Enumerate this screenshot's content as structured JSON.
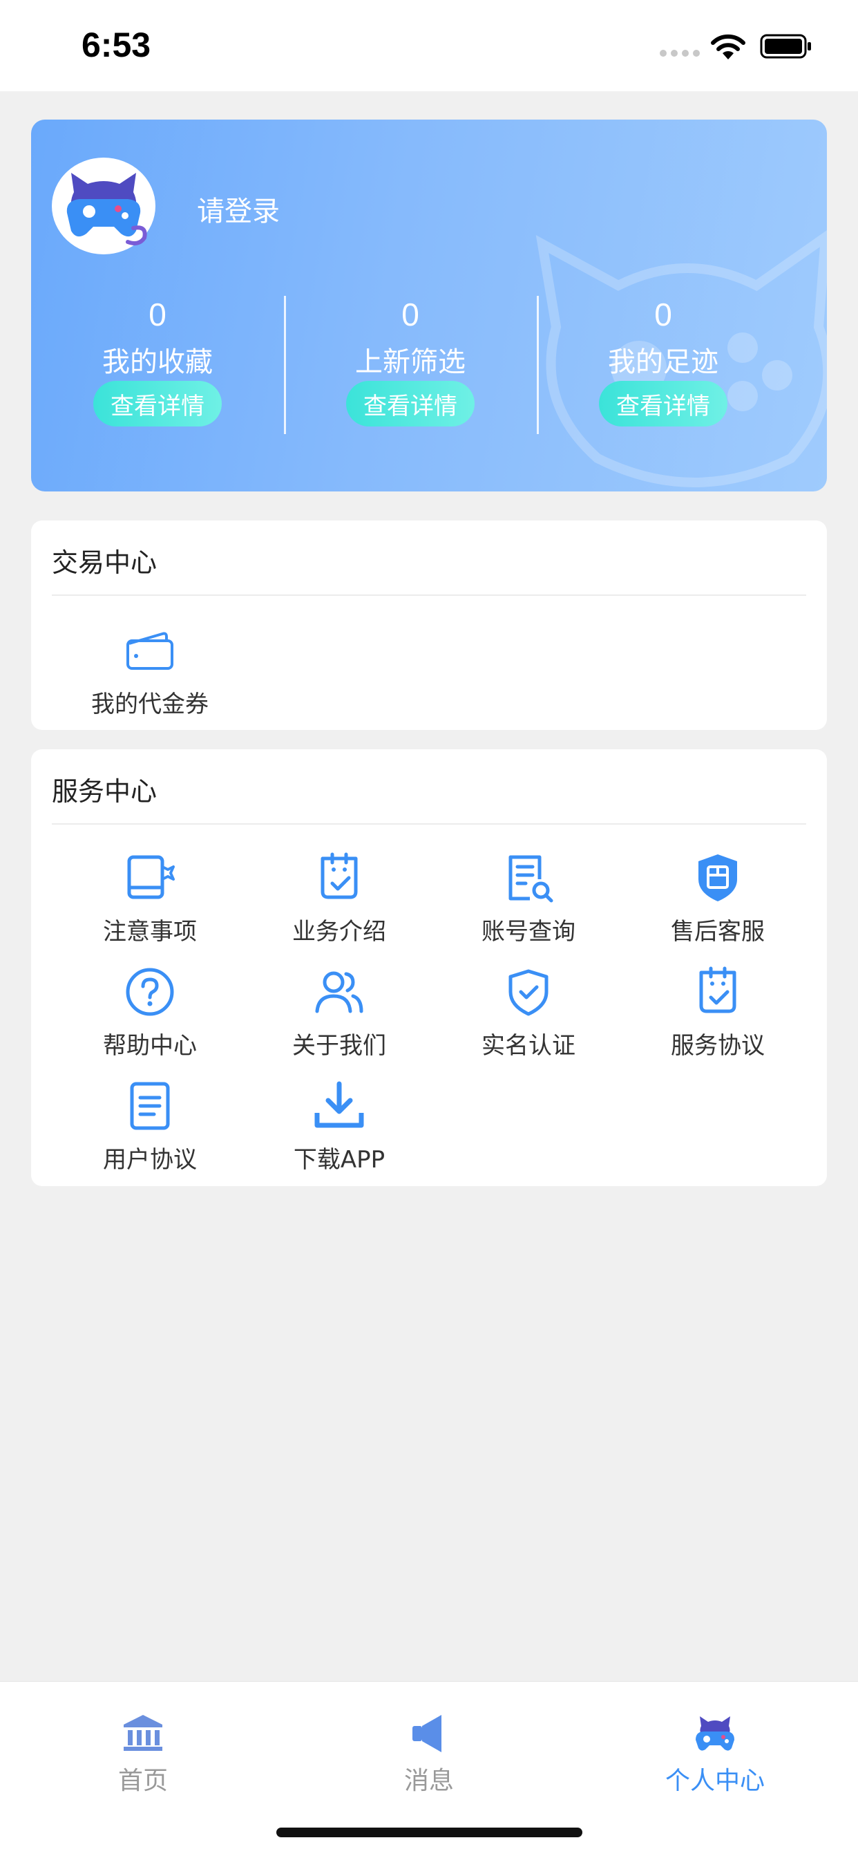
{
  "status_bar": {
    "time": "6:53"
  },
  "profile": {
    "login_text": "请登录",
    "stats": [
      {
        "value": "0",
        "label": "我的收藏",
        "button": "查看详情"
      },
      {
        "value": "0",
        "label": "上新筛选",
        "button": "查看详情"
      },
      {
        "value": "0",
        "label": "我的足迹",
        "button": "查看详情"
      }
    ]
  },
  "trade_center": {
    "title": "交易中心",
    "items": [
      {
        "label": "我的代金券",
        "icon": "wallet-icon"
      }
    ]
  },
  "service_center": {
    "title": "服务中心",
    "items": [
      {
        "label": "注意事项",
        "icon": "notebook-icon"
      },
      {
        "label": "业务介绍",
        "icon": "clipboard-check-icon"
      },
      {
        "label": "账号查询",
        "icon": "document-search-icon"
      },
      {
        "label": "售后客服",
        "icon": "shield-service-icon"
      },
      {
        "label": "帮助中心",
        "icon": "help-circle-icon"
      },
      {
        "label": "关于我们",
        "icon": "users-icon"
      },
      {
        "label": "实名认证",
        "icon": "shield-check-icon"
      },
      {
        "label": "服务协议",
        "icon": "clipboard-check-icon"
      },
      {
        "label": "用户协议",
        "icon": "document-lines-icon"
      },
      {
        "label": "下载APP",
        "icon": "download-icon"
      }
    ]
  },
  "tab_bar": {
    "tabs": [
      {
        "label": "首页",
        "icon": "bank-icon",
        "active": false
      },
      {
        "label": "消息",
        "icon": "megaphone-icon",
        "active": false
      },
      {
        "label": "个人中心",
        "icon": "gamepad-cat-icon",
        "active": true
      }
    ]
  },
  "colors": {
    "accent": "#3a8ff5",
    "card_gradient_start": "#6aa9fb",
    "card_gradient_end": "#9fcbfd",
    "button_teal": "#3be3d9"
  }
}
